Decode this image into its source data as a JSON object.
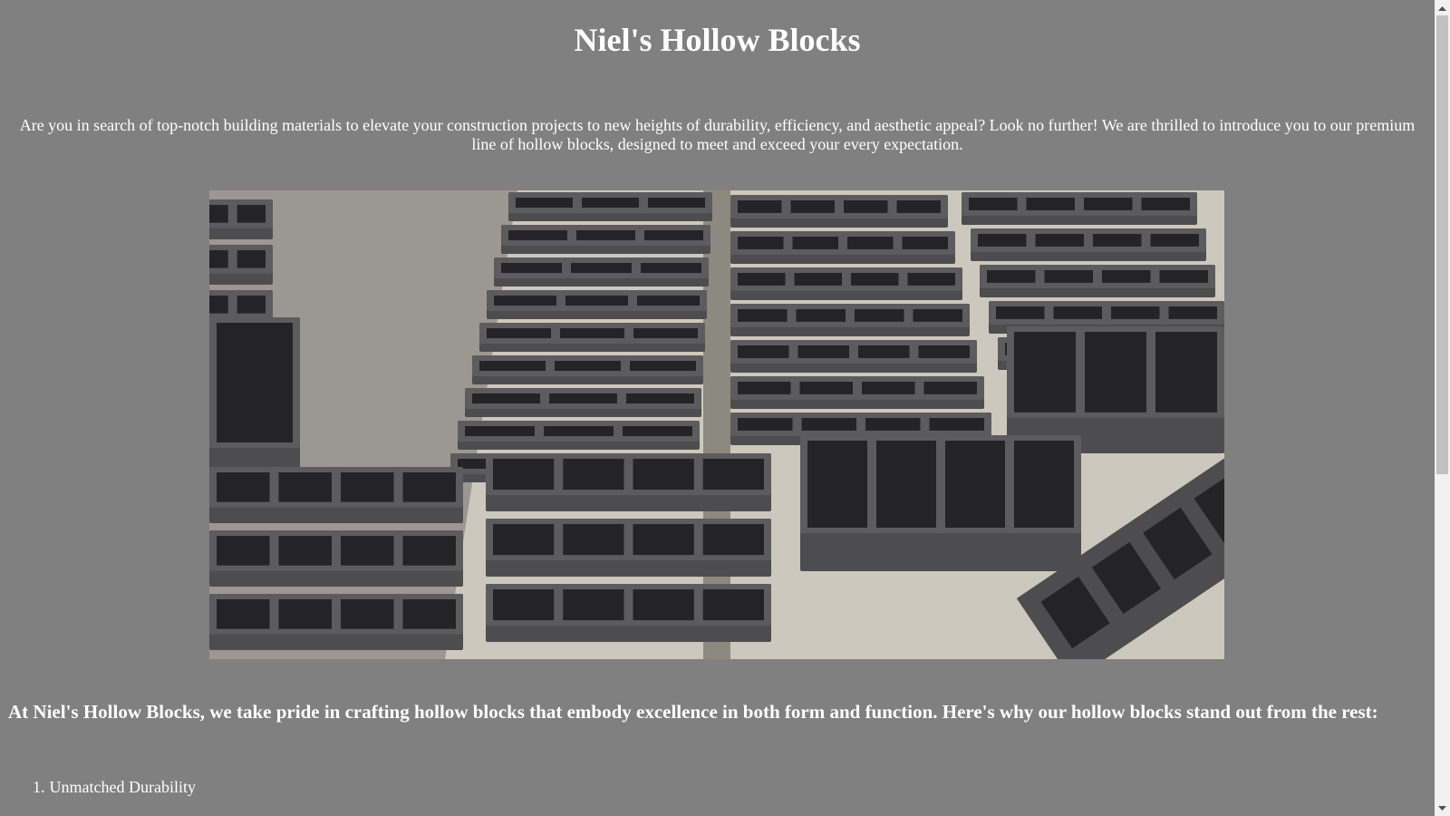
{
  "header": {
    "title": "Niel's Hollow Blocks"
  },
  "intro": {
    "text": "Are you in search of top-notch building materials to elevate your construction projects to new heights of durability, efficiency, and aesthetic appeal? Look no further! We are thrilled to introduce you to our premium line of hollow blocks, designed to meet and exceed your every expectation."
  },
  "hero_image": {
    "description_icon": "hollow-blocks-photo",
    "colors": {
      "ground": "#cdc8bd",
      "block_face": "#4d4d4f",
      "block_top": "#5c5c5e",
      "hole": "#242426"
    }
  },
  "benefits": {
    "heading": "At Niel's Hollow Blocks, we take pride in crafting hollow blocks that embody excellence in both form and function. Here's why our hollow blocks stand out from the rest:",
    "items": [
      {
        "number": "1.",
        "label": "Unmatched Durability"
      }
    ]
  },
  "colors": {
    "background": "#808080",
    "text": "#ffffff",
    "scrollbar_track": "#f1f1f1",
    "scrollbar_thumb": "#c1c1c1"
  }
}
